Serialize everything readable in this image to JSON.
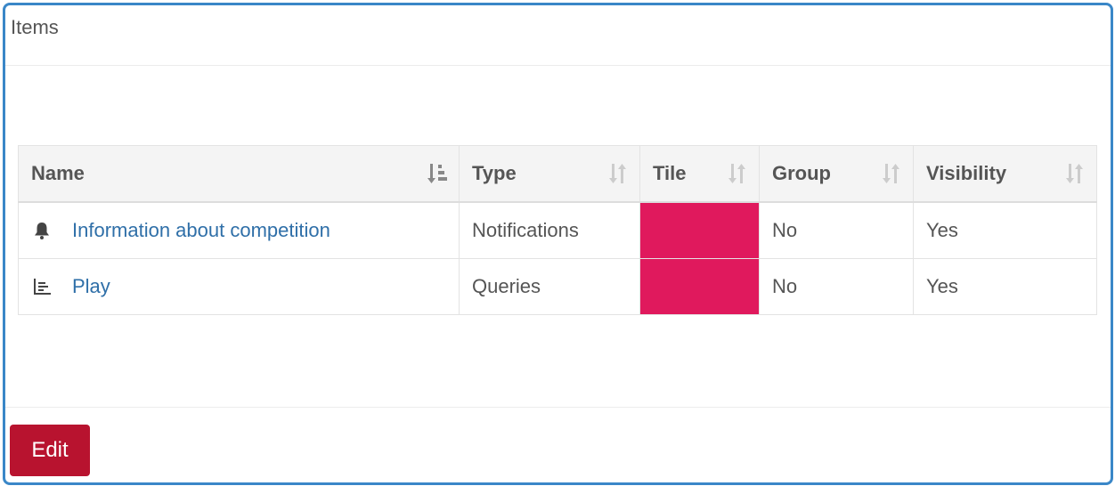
{
  "panel": {
    "title": "Items"
  },
  "table": {
    "columns": [
      {
        "label": "Name",
        "sort": "ascending"
      },
      {
        "label": "Type",
        "sort": "none"
      },
      {
        "label": "Tile",
        "sort": "none"
      },
      {
        "label": "Group",
        "sort": "none"
      },
      {
        "label": "Visibility",
        "sort": "none"
      }
    ],
    "rows": [
      {
        "icon": "bell-icon",
        "name": "Information about competition",
        "type": "Notifications",
        "tile_color": "#e0195d",
        "group": "No",
        "visibility": "Yes"
      },
      {
        "icon": "bar-chart-icon",
        "name": "Play",
        "type": "Queries",
        "tile_color": "#e0195d",
        "group": "No",
        "visibility": "Yes"
      }
    ]
  },
  "footer": {
    "edit_label": "Edit"
  },
  "colors": {
    "accent_border": "#3a87c8",
    "link": "#2f6fa8",
    "edit_button": "#b8132f"
  }
}
